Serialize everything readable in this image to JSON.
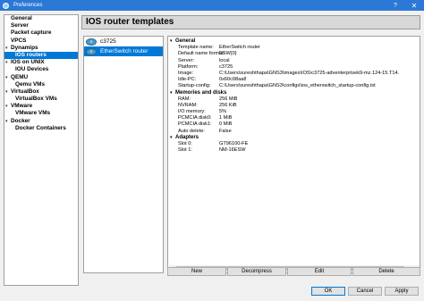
{
  "window": {
    "title": "Preferences",
    "help_glyph": "?",
    "close_glyph": "✕"
  },
  "nav": {
    "items": [
      {
        "label": "General",
        "level": 0,
        "expander": ""
      },
      {
        "label": "Server",
        "level": 0,
        "expander": ""
      },
      {
        "label": "Packet capture",
        "level": 0,
        "expander": ""
      },
      {
        "label": "VPCS",
        "level": 0,
        "expander": ""
      },
      {
        "label": "Dynamips",
        "level": 0,
        "expander": "▾"
      },
      {
        "label": "IOS routers",
        "level": 1,
        "expander": "",
        "selected": true
      },
      {
        "label": "IOS on UNIX",
        "level": 0,
        "expander": "▾"
      },
      {
        "label": "IOU Devices",
        "level": 1,
        "expander": ""
      },
      {
        "label": "QEMU",
        "level": 0,
        "expander": "▾"
      },
      {
        "label": "Qemu VMs",
        "level": 1,
        "expander": ""
      },
      {
        "label": "VirtualBox",
        "level": 0,
        "expander": "▾"
      },
      {
        "label": "VirtualBox VMs",
        "level": 1,
        "expander": ""
      },
      {
        "label": "VMware",
        "level": 0,
        "expander": "▾"
      },
      {
        "label": "VMware VMs",
        "level": 1,
        "expander": ""
      },
      {
        "label": "Docker",
        "level": 0,
        "expander": "▾"
      },
      {
        "label": "Docker Containers",
        "level": 1,
        "expander": ""
      }
    ]
  },
  "page": {
    "title": "IOS router templates"
  },
  "templates": [
    {
      "label": "c3725",
      "icon": "router-icon",
      "selected": false
    },
    {
      "label": "EtherSwitch router",
      "icon": "router-icon",
      "selected": true
    }
  ],
  "properties": [
    {
      "section": "General",
      "expander": "▾",
      "rows": [
        {
          "key": "Template name:",
          "value": "EtherSwitch router"
        },
        {
          "key": "Default name format:",
          "value": "ESW{0}"
        },
        {
          "key": "Server:",
          "value": "local"
        },
        {
          "key": "Platform:",
          "value": "c3725"
        },
        {
          "key": "Image:",
          "value": "C:\\Users\\sureshthapa\\GNS3\\images\\IOS\\c3725-adventerprisek9-mz.124-15.T14."
        },
        {
          "key": "Idle-PC:",
          "value": "0x60c08aa8"
        },
        {
          "key": "Startup-config:",
          "value": "C:\\Users\\sureshthapa\\GNS3\\configs\\ios_etherswitch_startup-config.txt"
        }
      ]
    },
    {
      "section": "Memories and disks",
      "expander": "▾",
      "rows": [
        {
          "key": "RAM:",
          "value": "256 MiB"
        },
        {
          "key": "NVRAM:",
          "value": "256 KiB"
        },
        {
          "key": "I/O memory:",
          "value": "5%"
        },
        {
          "key": "PCMCIA disk0:",
          "value": "1 MiB"
        },
        {
          "key": "PCMCIA disk1:",
          "value": "0 MiB"
        },
        {
          "key": "Auto delete:",
          "value": "False"
        }
      ]
    },
    {
      "section": "Adapters",
      "expander": "▾",
      "rows": [
        {
          "key": "Slot 0:",
          "value": "GT96100-FE"
        },
        {
          "key": "Slot 1:",
          "value": "NM-16ESW"
        }
      ]
    }
  ],
  "scrollbar": {
    "left_arrow": "◀",
    "right_arrow": "▶"
  },
  "buttons": {
    "new": "New",
    "decompress": "Decompress",
    "edit": "Edit",
    "delete": "Delete",
    "ok": "OK",
    "cancel": "Cancel",
    "apply": "Apply"
  }
}
